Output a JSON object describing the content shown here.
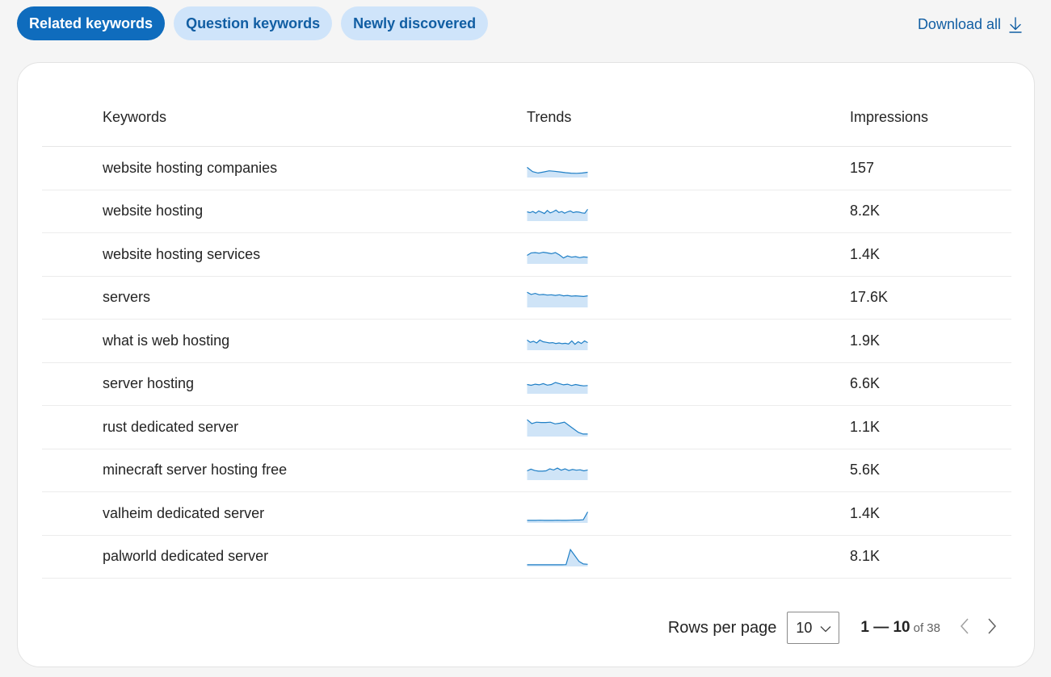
{
  "tabs": [
    {
      "label": "Related keywords",
      "active": true
    },
    {
      "label": "Question keywords",
      "active": false
    },
    {
      "label": "Newly discovered",
      "active": false
    }
  ],
  "download": {
    "label": "Download all",
    "icon": "download-icon"
  },
  "table": {
    "headers": {
      "keywords": "Keywords",
      "trends": "Trends",
      "impressions": "Impressions"
    },
    "rows": [
      {
        "keyword": "website hosting companies",
        "impressions": "157",
        "trend": [
          0.55,
          0.3,
          0.22,
          0.28,
          0.35,
          0.32,
          0.28,
          0.24,
          0.21,
          0.2,
          0.22,
          0.26
        ]
      },
      {
        "keyword": "website hosting",
        "impressions": "8.2K",
        "trend": [
          0.5,
          0.45,
          0.52,
          0.42,
          0.55,
          0.48,
          0.4,
          0.58,
          0.44,
          0.5,
          0.6,
          0.46,
          0.52,
          0.42,
          0.5,
          0.55,
          0.45,
          0.5,
          0.48,
          0.44,
          0.42,
          0.65
        ]
      },
      {
        "keyword": "website hosting services",
        "impressions": "1.4K",
        "trend": [
          0.45,
          0.6,
          0.62,
          0.58,
          0.64,
          0.6,
          0.55,
          0.62,
          0.48,
          0.3,
          0.42,
          0.35,
          0.38,
          0.32,
          0.36,
          0.34
        ]
      },
      {
        "keyword": "servers",
        "impressions": "17.6K",
        "trend": [
          0.85,
          0.72,
          0.78,
          0.7,
          0.72,
          0.68,
          0.7,
          0.66,
          0.7,
          0.64,
          0.66,
          0.62,
          0.64,
          0.62,
          0.6,
          0.64
        ]
      },
      {
        "keyword": "what is web hosting",
        "impressions": "1.9K",
        "trend": [
          0.55,
          0.42,
          0.48,
          0.38,
          0.55,
          0.45,
          0.42,
          0.38,
          0.4,
          0.35,
          0.38,
          0.34,
          0.36,
          0.32,
          0.5,
          0.3,
          0.45,
          0.35,
          0.5,
          0.4
        ]
      },
      {
        "keyword": "server hosting",
        "impressions": "6.6K",
        "trend": [
          0.5,
          0.45,
          0.52,
          0.48,
          0.55,
          0.46,
          0.5,
          0.62,
          0.55,
          0.48,
          0.52,
          0.44,
          0.5,
          0.45,
          0.42,
          0.44
        ]
      },
      {
        "keyword": "rust dedicated server",
        "impressions": "1.1K",
        "trend": [
          0.95,
          0.72,
          0.8,
          0.78,
          0.78,
          0.8,
          0.7,
          0.74,
          0.8,
          0.6,
          0.4,
          0.2,
          0.1,
          0.1
        ]
      },
      {
        "keyword": "minecraft server hosting free",
        "impressions": "5.6K",
        "trend": [
          0.5,
          0.6,
          0.52,
          0.48,
          0.48,
          0.5,
          0.62,
          0.55,
          0.66,
          0.54,
          0.62,
          0.52,
          0.58,
          0.54,
          0.56,
          0.5,
          0.55
        ]
      },
      {
        "keyword": "valheim dedicated server",
        "impressions": "1.4K",
        "trend": [
          0.1,
          0.1,
          0.1,
          0.11,
          0.1,
          0.1,
          0.1,
          0.11,
          0.1,
          0.1,
          0.11,
          0.12,
          0.12,
          0.14,
          0.6
        ]
      },
      {
        "keyword": "palworld dedicated server",
        "impressions": "8.1K",
        "trend": [
          0.05,
          0.05,
          0.05,
          0.05,
          0.05,
          0.05,
          0.05,
          0.05,
          0.05,
          0.06,
          0.95,
          0.6,
          0.25,
          0.1,
          0.08
        ]
      }
    ]
  },
  "pagination": {
    "rows_per_page_label": "Rows per page",
    "rows_per_page_value": "10",
    "range": "1 — 10",
    "of_total": "of 38"
  },
  "colors": {
    "accent": "#0f6cbd",
    "tab_inactive": "#cfe4fa",
    "trend_line": "#1f7fc6",
    "trend_fill": "#cfe4f7"
  }
}
